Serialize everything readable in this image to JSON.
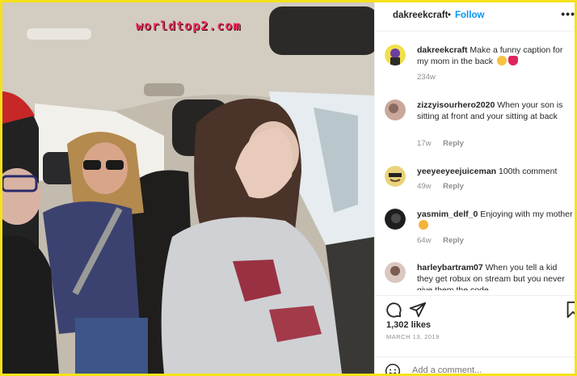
{
  "watermark": "worldtop2.com",
  "post": {
    "username": "dakreekcraft",
    "separator": "•",
    "follow_label": "Follow",
    "more_label": "•••"
  },
  "comments": [
    {
      "user": "dakreekcraft",
      "text": "Make a funny caption for my mom in the back",
      "emoji": [
        "laughing-face",
        "red-heart"
      ],
      "time": "234w",
      "reply": ""
    },
    {
      "user": "zizzyisourhero2020",
      "text": "When your son is sitting at front and your sitting at back",
      "emoji": [],
      "time": "17w",
      "reply": "Reply"
    },
    {
      "user": "yeeyeeyeejuiceman",
      "text": "100th comment",
      "emoji": [],
      "time": "49w",
      "reply": "Reply"
    },
    {
      "user": "yasmim_delf_0",
      "text": "Enjoying with my mother",
      "emoji": [
        "screaming-face"
      ],
      "time": "64w",
      "reply": "Reply"
    },
    {
      "user": "harleybartram07",
      "text": "When you tell a kid they get robux on stream but you never give them the code",
      "emoji": [],
      "time": "",
      "reply": ""
    }
  ],
  "actions": {
    "icons": [
      "comment-icon",
      "share-icon",
      "save-icon"
    ]
  },
  "likes": "1,302 likes",
  "date": "MARCH 13, 2019",
  "add_comment": {
    "placeholder": "Add a comment..."
  },
  "colors": {
    "follow": "#0095f6",
    "border": "#f5e21a",
    "muted": "#8e8e8e"
  }
}
